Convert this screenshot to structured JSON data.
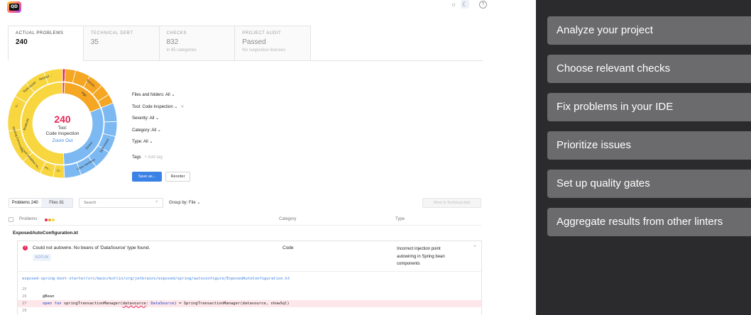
{
  "app": {
    "logo_text": "QD",
    "header_icons": [
      "sun-icon",
      "moon-icon",
      "help-icon"
    ]
  },
  "tabs": [
    {
      "title": "ACTUAL PROBLEMS",
      "value": "240",
      "sub": ""
    },
    {
      "title": "TECHNICAL DEBT",
      "value": "35",
      "sub": ""
    },
    {
      "title": "CHECKS",
      "value": "832",
      "sub": "in 85 categories"
    },
    {
      "title": "PROJECT AUDIT",
      "value": "Passed",
      "sub": "No suspicious licenses"
    }
  ],
  "sunburst": {
    "count": "240",
    "tool_label": "Tool:",
    "tool_name": "Code Inspection",
    "zoom_out": "Zoom Out",
    "inner_labels": [
      "High",
      "Moderate",
      "Severe"
    ],
    "outer_labels": [
      "Needed ...",
      "Style issues",
      "U...",
      "Naming Conventions",
      "Local variables na...",
      "Po...",
      "Cl...",
      "Technic...",
      "Style issues",
      "Class members"
    ],
    "colors": {
      "yellow": "#f7d63f",
      "orange": "#f5a623",
      "blue": "#7cb9f2",
      "red": "#e8275a"
    }
  },
  "filters": {
    "files": "Files and folders: All",
    "tool": "Tool: Code Inspection",
    "severity": "Severity: All",
    "category": "Category: All",
    "type": "Type: All",
    "tags_label": "Tags",
    "tags_add": "+ Add tag",
    "save": "Save as...",
    "reorder": "Reorder"
  },
  "toolbar": {
    "problems_label": "Problems",
    "problems_count": "240",
    "files_label": "Files",
    "files_count": "81",
    "search_placeholder": "Search",
    "group_by": "Group by: File",
    "move": "Move to Technical debt"
  },
  "table": {
    "col_problems": "Problems",
    "col_category": "Category",
    "col_type": "Type"
  },
  "problem": {
    "file": "ExposedAutoConfiguration.kt",
    "message": "Could not autowire. No beans of 'DataSource' type found.",
    "language": "KOTLIN",
    "category": "Code",
    "type": "Incorrect injection point autowiring in Spring bean components",
    "path": "exposed-spring-boot-starter/src/main/kotlin/org/jetbrains/exposed/spring/autoconfigure/ExposedAutoConfiguration.kt",
    "lines": [
      {
        "n": "25",
        "code": ""
      },
      {
        "n": "26",
        "code": "@Bean"
      },
      {
        "n": "27",
        "code": "open fun springTransactionManager(datasource: DataSource) = SpringTransactionManager(datasource, showSql)"
      },
      {
        "n": "28",
        "code": ""
      }
    ]
  },
  "sidebar": {
    "items": [
      "Analyze your project",
      "Choose relevant checks",
      "Fix problems in your IDE",
      "Prioritize issues",
      "Set up quality gates",
      "Aggregate results from other linters"
    ]
  }
}
